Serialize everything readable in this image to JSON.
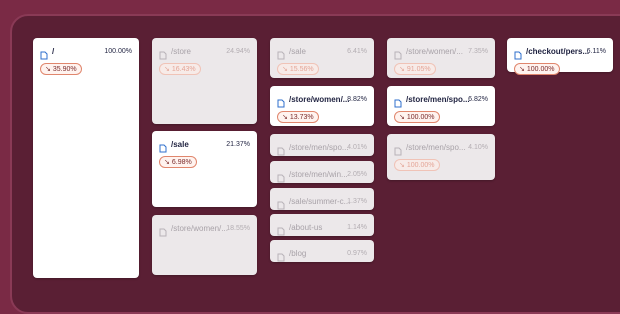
{
  "colors": {
    "background": "#7a2a45",
    "frame": "#5a1f34",
    "card": "#ffffff",
    "card_dim": "#ece8ea",
    "text": "#1f2240",
    "badge_border": "#e0866d",
    "icon": "#2f6fcc"
  },
  "icons": {
    "page": "page-icon",
    "trend": "trend-down-icon"
  },
  "nodes": [
    {
      "id": "root",
      "path": "/",
      "pct": "100.00%",
      "change": "35.90%",
      "highlight": true
    },
    {
      "id": "store",
      "path": "/store",
      "pct": "24.94%",
      "change": "16.43%",
      "highlight": false
    },
    {
      "id": "sale",
      "path": "/sale",
      "pct": "21.37%",
      "change": "6.98%",
      "highlight": true
    },
    {
      "id": "store-women-1",
      "path": "/store/women/...",
      "pct": "18.55%",
      "change": null,
      "highlight": false
    },
    {
      "id": "sale-2",
      "path": "/sale",
      "pct": "6.41%",
      "change": "15.56%",
      "highlight": false
    },
    {
      "id": "store-women-2",
      "path": "/store/women/...",
      "pct": "8.82%",
      "change": "13.73%",
      "highlight": true
    },
    {
      "id": "store-men-spo-1",
      "path": "/store/men/spo...",
      "pct": "4.01%",
      "change": null,
      "highlight": false
    },
    {
      "id": "store-men-win",
      "path": "/store/men/win...",
      "pct": "2.05%",
      "change": null,
      "highlight": false
    },
    {
      "id": "sale-summer",
      "path": "/sale/summer-c...",
      "pct": "1.37%",
      "change": null,
      "highlight": false
    },
    {
      "id": "about-us",
      "path": "/about-us",
      "pct": "1.14%",
      "change": null,
      "highlight": false
    },
    {
      "id": "blog",
      "path": "/blog",
      "pct": "0.97%",
      "change": null,
      "highlight": false
    },
    {
      "id": "store-women-3",
      "path": "/store/women/...",
      "pct": "7.35%",
      "change": "91.05%",
      "highlight": false
    },
    {
      "id": "store-men-spo-2",
      "path": "/store/men/spo...",
      "pct": "6.82%",
      "change": "100.00%",
      "highlight": true
    },
    {
      "id": "store-men-spo-3",
      "path": "/store/men/spo...",
      "pct": "4.10%",
      "change": "100.00%",
      "highlight": false
    },
    {
      "id": "checkout",
      "path": "/checkout/pers...",
      "pct": "6.11%",
      "change": "100.00%",
      "highlight": true
    }
  ]
}
